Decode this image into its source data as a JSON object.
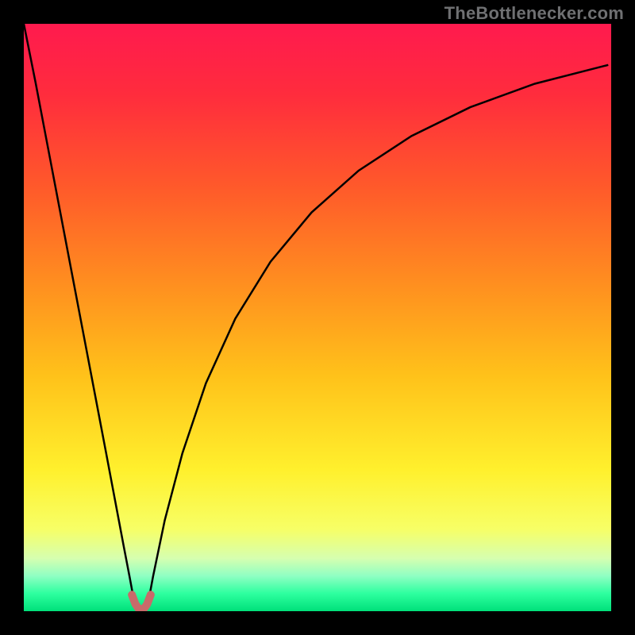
{
  "watermark": "TheBottlenecker.com",
  "chart_data": {
    "type": "line",
    "title": "",
    "xlabel": "",
    "ylabel": "",
    "xlim": [
      0,
      100
    ],
    "ylim": [
      0,
      100
    ],
    "background_gradient": {
      "stops": [
        {
          "offset": 0.0,
          "color": "#ff1a4e"
        },
        {
          "offset": 0.12,
          "color": "#ff2c3d"
        },
        {
          "offset": 0.28,
          "color": "#ff5a2a"
        },
        {
          "offset": 0.45,
          "color": "#ff911f"
        },
        {
          "offset": 0.6,
          "color": "#ffc21a"
        },
        {
          "offset": 0.76,
          "color": "#fff02d"
        },
        {
          "offset": 0.86,
          "color": "#f7ff66"
        },
        {
          "offset": 0.91,
          "color": "#d6ffb0"
        },
        {
          "offset": 0.94,
          "color": "#8fffc3"
        },
        {
          "offset": 0.97,
          "color": "#2dff9f"
        },
        {
          "offset": 1.0,
          "color": "#00e07a"
        }
      ]
    },
    "series": [
      {
        "name": "bottleneck-curve",
        "color": "#000000",
        "stroke_width": 2.5,
        "x": [
          0,
          2,
          4,
          6,
          8,
          10,
          12,
          14,
          15,
          16,
          17,
          18,
          18.5,
          19,
          19.5,
          20,
          20.5,
          21,
          21.5,
          22,
          24,
          27,
          31,
          36,
          42,
          49,
          57,
          66,
          76,
          87,
          99.5
        ],
        "y": [
          100,
          90,
          79.5,
          69,
          58.5,
          48,
          37.5,
          27,
          21.7,
          16.4,
          11.1,
          5.9,
          3.2,
          1.4,
          0.5,
          0.2,
          0.5,
          1.4,
          3.2,
          5.9,
          15.5,
          26.9,
          38.8,
          49.8,
          59.5,
          67.9,
          75.0,
          80.9,
          85.8,
          89.8,
          93.0
        ]
      },
      {
        "name": "bottom-markers",
        "type": "marker-path",
        "color": "#c86a6a",
        "stroke_width": 10,
        "x": [
          18.4,
          19.0,
          19.5,
          20.0,
          20.5,
          21.0,
          21.6
        ],
        "y": [
          2.8,
          1.2,
          0.5,
          0.3,
          0.5,
          1.2,
          2.8
        ]
      }
    ]
  }
}
